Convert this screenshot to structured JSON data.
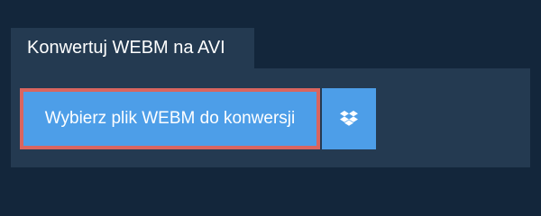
{
  "tab": {
    "title": "Konwertuj WEBM na AVI"
  },
  "upload": {
    "choose_label": "Wybierz plik WEBM do konwersji",
    "dropbox_icon": "dropbox-icon"
  },
  "colors": {
    "background": "#13263b",
    "panel": "#243a51",
    "button": "#4d9ee8",
    "button_focus_border": "#d9655f",
    "text": "#ffffff"
  }
}
